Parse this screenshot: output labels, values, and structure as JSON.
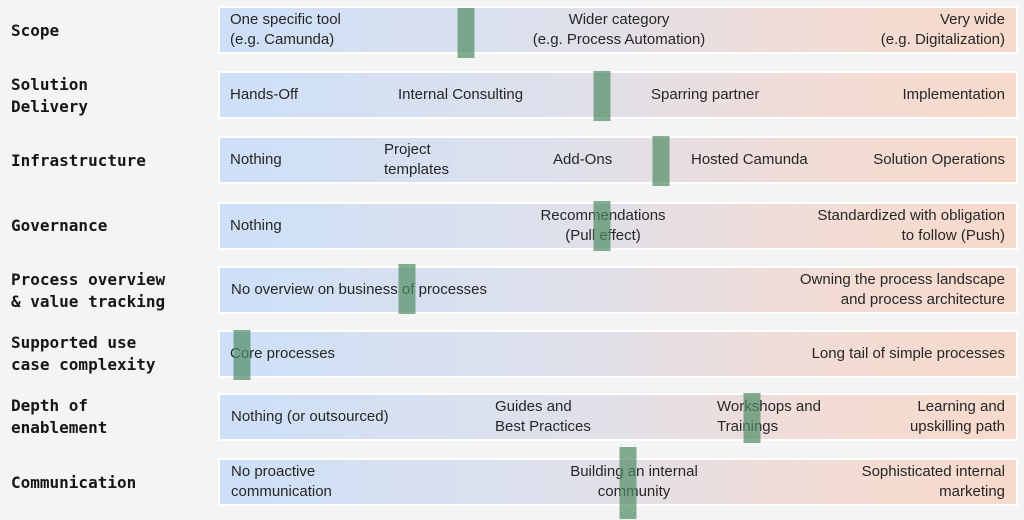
{
  "colors": {
    "background": "#f4f4f4",
    "bar_start": "#cde0f8",
    "bar_end": "#f7dacb",
    "marker": "#6a9e80"
  },
  "rows": [
    {
      "label": "Scope",
      "marker_position": 0.31,
      "items": [
        "One specific tool\n(e.g. Camunda)",
        "Wider category\n(e.g. Process Automation)",
        "Very wide\n(e.g. Digitalization)"
      ]
    },
    {
      "label": "Solution\nDelivery",
      "marker_position": 0.48,
      "items": [
        "Hands-Off",
        "Internal Consulting",
        "Sparring partner",
        "Implementation"
      ]
    },
    {
      "label": "Infrastructure",
      "marker_position": 0.554,
      "items": [
        "Nothing",
        "Project\ntemplates",
        "Add-Ons",
        "Hosted Camunda",
        "Solution Operations"
      ]
    },
    {
      "label": "Governance",
      "marker_position": 0.48,
      "items": [
        "Nothing",
        "Recommendations\n(Pull effect)",
        "Standardized with obligation\nto follow (Push)"
      ]
    },
    {
      "label": "Process overview\n& value tracking",
      "marker_position": 0.236,
      "items": [
        "No overview on business of processes",
        "Owning the process landscape\nand process architecture"
      ]
    },
    {
      "label": "Supported use\ncase complexity",
      "marker_position": 0.03,
      "items": [
        "Core processes",
        "Long tail of simple processes"
      ]
    },
    {
      "label": "Depth of\nenablement",
      "marker_position": 0.668,
      "items": [
        "Nothing (or outsourced)",
        "Guides and\nBest Practices",
        "Workshops and\nTrainings",
        "Learning and\nupskilling path"
      ]
    },
    {
      "label": "Communication",
      "marker_position": 0.513,
      "items": [
        "No proactive\ncommunication",
        "Building an internal\ncommunity",
        "Sophisticated internal\nmarketing"
      ]
    }
  ]
}
